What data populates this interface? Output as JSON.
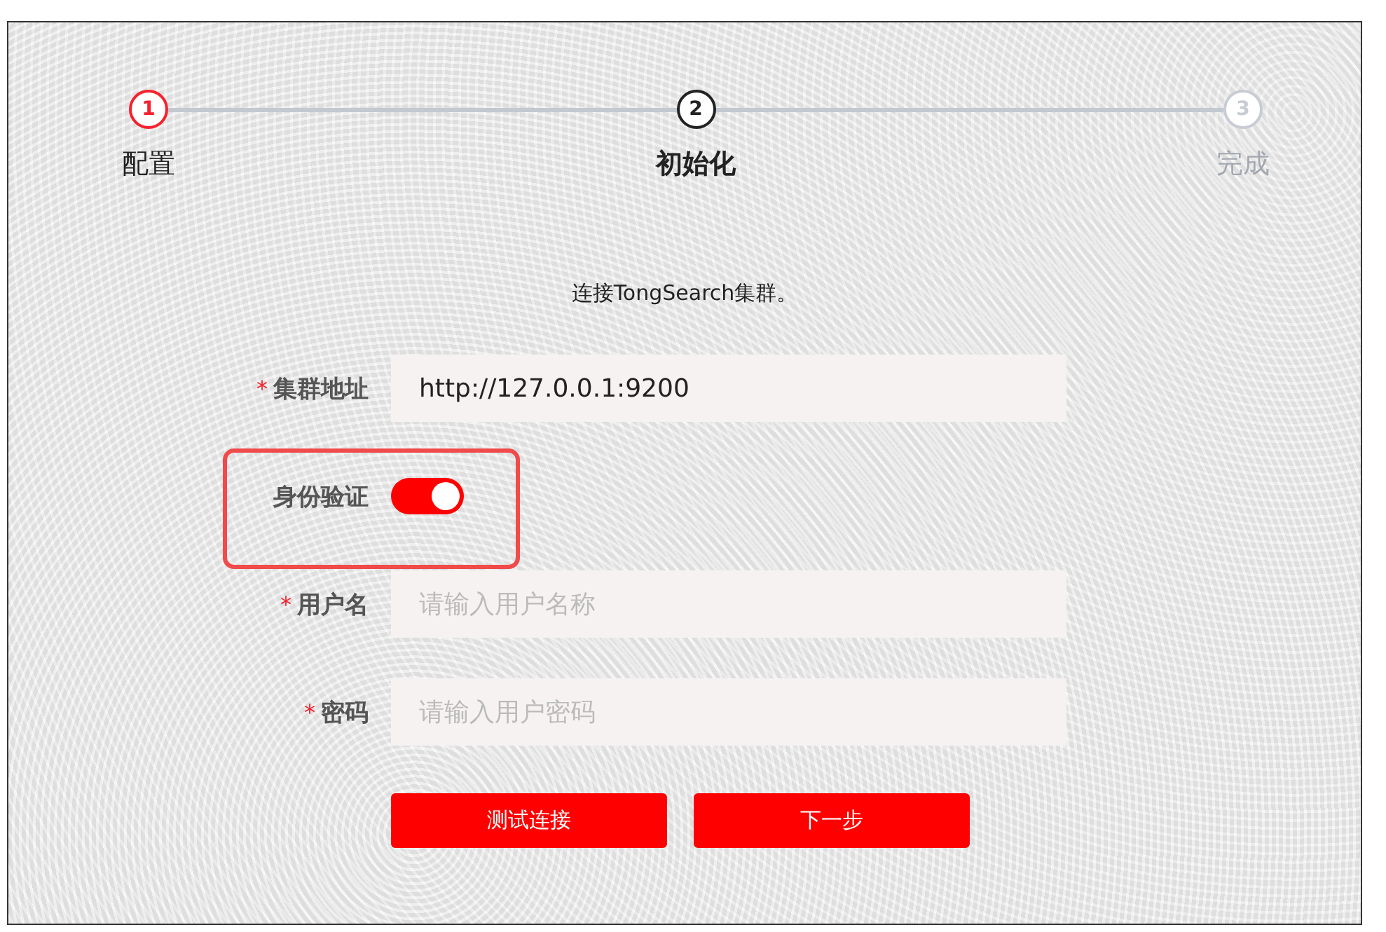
{
  "steps": [
    {
      "number": "1",
      "label": "配置",
      "done": true,
      "selected": false
    },
    {
      "number": "2",
      "label": "初始化",
      "done": false,
      "selected": true
    },
    {
      "number": "3",
      "label": "完成",
      "done": false,
      "selected": false
    }
  ],
  "intro": "连接TongSearch集群。",
  "fields": [
    {
      "kind": "input",
      "label": "集群地址",
      "required_mark": "*",
      "value": "http://127.0.0.1:9200",
      "highlighted": false
    },
    {
      "kind": "switch",
      "label": "身份验证",
      "on": true,
      "highlighted": true
    },
    {
      "kind": "input",
      "label": "用户名",
      "required_mark": "*",
      "placeholder": "请输入用户名称",
      "highlighted": false
    },
    {
      "kind": "input",
      "label": "密码",
      "required_mark": "*",
      "placeholder": "请输入用户密码",
      "highlighted": false
    }
  ],
  "buttons": [
    "测试连接",
    "下一步"
  ]
}
